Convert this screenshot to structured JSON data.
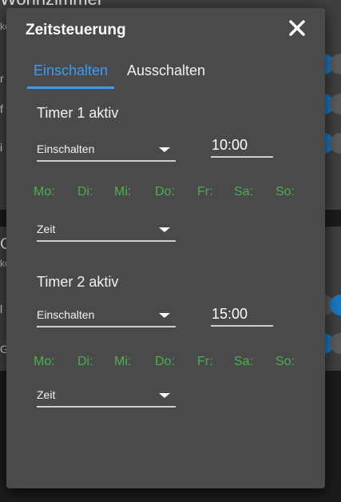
{
  "background": {
    "room_title": "Wohnzimmer",
    "section2_title_fragment": "G",
    "fragment_ko_1": "ko",
    "fragment_r": "r",
    "fragment_f": "f",
    "fragment_i": "i",
    "fragment_ko_2": "ko",
    "fragment_l": "l",
    "fragment_g": "G",
    "toggle_on_color": "#1a78c2",
    "toggle_off_color": "#5a5a5a"
  },
  "dialog": {
    "title": "Zeitsteuerung",
    "close_icon": "close-icon",
    "tabs": [
      {
        "label": "Einschalten",
        "active": true
      },
      {
        "label": "Ausschalten",
        "active": false
      }
    ],
    "timers": [
      {
        "label": "Timer 1 aktiv",
        "action": "Einschalten",
        "time": "10:00",
        "days": [
          "Mo:",
          "Di:",
          "Mi:",
          "Do:",
          "Fr:",
          "Sa:",
          "So:"
        ],
        "mode": "Zeit"
      },
      {
        "label": "Timer 2 aktiv",
        "action": "Einschalten",
        "time": "15:00",
        "days": [
          "Mo:",
          "Di:",
          "Mi:",
          "Do:",
          "Fr:",
          "Sa:",
          "So:"
        ],
        "mode": "Zeit"
      }
    ]
  },
  "colors": {
    "accent": "#3c9cf5",
    "day_active": "#4caf50",
    "dialog_bg": "#4a4a4a"
  }
}
